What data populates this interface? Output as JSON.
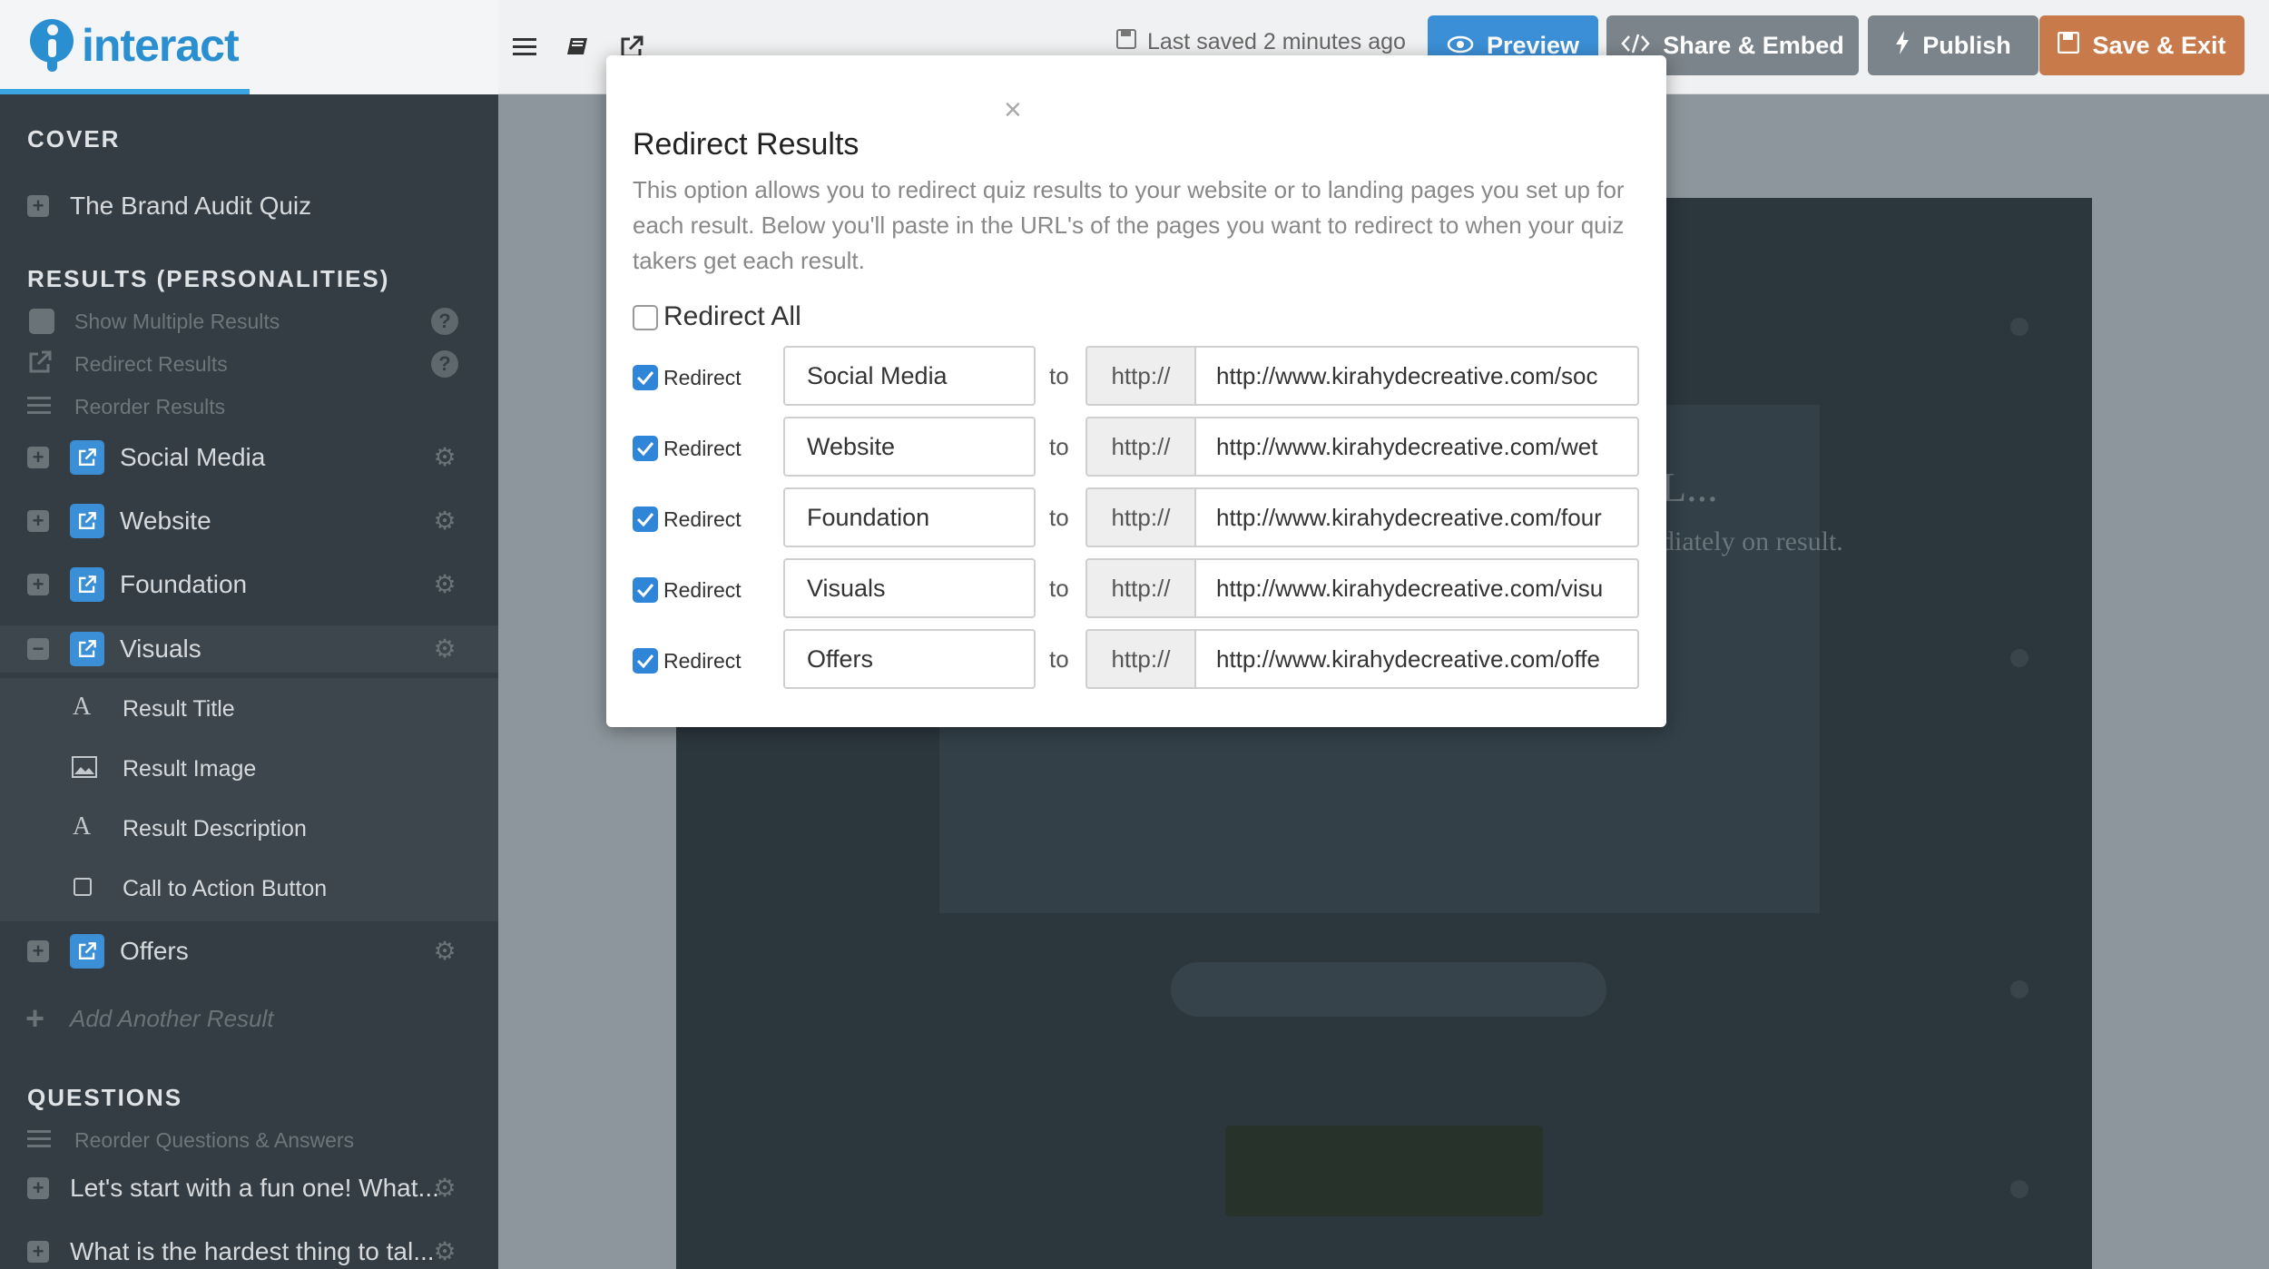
{
  "app": {
    "logo_text": "interact",
    "last_saved": "Last saved 2 minutes ago",
    "buttons": {
      "preview": "Preview",
      "share": "Share & Embed",
      "publish": "Publish",
      "save": "Save & Exit"
    }
  },
  "sidebar": {
    "cover_heading": "COVER",
    "cover_item": "The Brand Audit Quiz",
    "results_heading": "RESULTS (PERSONALITIES)",
    "show_multiple": "Show Multiple Results",
    "redirect_results": "Redirect Results",
    "reorder_results": "Reorder Results",
    "results": [
      "Social Media",
      "Website",
      "Foundation",
      "Visuals",
      "Offers"
    ],
    "visuals_children": [
      "Result Title",
      "Result Image",
      "Result Description",
      "Call to Action Button"
    ],
    "add_result": "Add Another Result",
    "questions_heading": "QUESTIONS",
    "reorder_questions": "Reorder Questions & Answers",
    "questions": [
      "Let's start with a fun one! What...",
      "What is the hardest thing to tal..."
    ]
  },
  "background": {
    "heading_fragment": "L...",
    "sub_fragment": "diately on result."
  },
  "modal": {
    "close": "×",
    "title": "Redirect Results",
    "description": "This option allows you to redirect quiz results to your website or to landing pages you set up for each result. Below you'll paste in the URL's of the pages you want to redirect to when your quiz takers get each result.",
    "redirect_all": "Redirect All",
    "row_label": "Redirect",
    "to": "to",
    "protocol": "http://",
    "rows": [
      {
        "name": "Social Media",
        "url": "http://www.kirahydecreative.com/soc"
      },
      {
        "name": "Website",
        "url": "http://www.kirahydecreative.com/wet"
      },
      {
        "name": "Foundation",
        "url": "http://www.kirahydecreative.com/four"
      },
      {
        "name": "Visuals",
        "url": "http://www.kirahydecreative.com/visu"
      },
      {
        "name": "Offers",
        "url": "http://www.kirahydecreative.com/offe"
      }
    ]
  },
  "colors": {
    "accent": "#3b8fd6",
    "sidebar": "#333d43",
    "save_button": "#c97a4b"
  }
}
